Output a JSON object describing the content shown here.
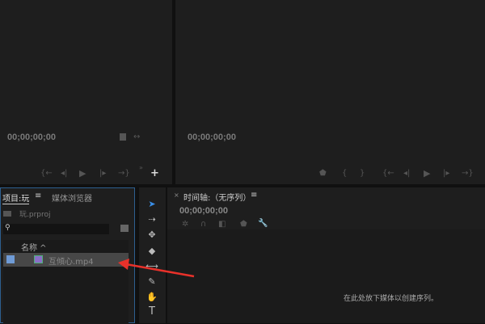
{
  "source_monitor": {
    "timecode": "00;00;00;00",
    "controls": [
      "mark-in",
      "step-back",
      "play",
      "step-forward",
      "mark-out"
    ]
  },
  "program_monitor": {
    "timecode": "00;00;00;00"
  },
  "project_panel": {
    "tab_active": "项目:玩",
    "tab_inactive": "媒体浏览器",
    "project_file": "玩.prproj",
    "search_placeholder": "",
    "column_name": "名称",
    "items": [
      {
        "name": "互傾心.mp4"
      }
    ]
  },
  "timeline": {
    "title": "时间轴:（无序列）",
    "timecode": "00;00;00;00",
    "empty_message": "在此处放下媒体以创建序列。"
  },
  "tools": {
    "type_tool": "T"
  },
  "annotation": {
    "arrow_color": "#e8312a"
  }
}
